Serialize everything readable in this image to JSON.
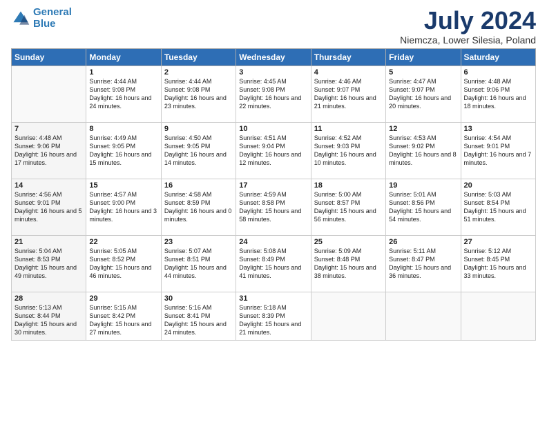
{
  "logo": {
    "line1": "General",
    "line2": "Blue"
  },
  "title": "July 2024",
  "subtitle": "Niemcza, Lower Silesia, Poland",
  "days_header": [
    "Sunday",
    "Monday",
    "Tuesday",
    "Wednesday",
    "Thursday",
    "Friday",
    "Saturday"
  ],
  "weeks": [
    [
      {
        "num": "",
        "sunrise": "",
        "sunset": "",
        "daylight": ""
      },
      {
        "num": "1",
        "sunrise": "Sunrise: 4:44 AM",
        "sunset": "Sunset: 9:08 PM",
        "daylight": "Daylight: 16 hours and 24 minutes."
      },
      {
        "num": "2",
        "sunrise": "Sunrise: 4:44 AM",
        "sunset": "Sunset: 9:08 PM",
        "daylight": "Daylight: 16 hours and 23 minutes."
      },
      {
        "num": "3",
        "sunrise": "Sunrise: 4:45 AM",
        "sunset": "Sunset: 9:08 PM",
        "daylight": "Daylight: 16 hours and 22 minutes."
      },
      {
        "num": "4",
        "sunrise": "Sunrise: 4:46 AM",
        "sunset": "Sunset: 9:07 PM",
        "daylight": "Daylight: 16 hours and 21 minutes."
      },
      {
        "num": "5",
        "sunrise": "Sunrise: 4:47 AM",
        "sunset": "Sunset: 9:07 PM",
        "daylight": "Daylight: 16 hours and 20 minutes."
      },
      {
        "num": "6",
        "sunrise": "Sunrise: 4:48 AM",
        "sunset": "Sunset: 9:06 PM",
        "daylight": "Daylight: 16 hours and 18 minutes."
      }
    ],
    [
      {
        "num": "7",
        "sunrise": "Sunrise: 4:48 AM",
        "sunset": "Sunset: 9:06 PM",
        "daylight": "Daylight: 16 hours and 17 minutes."
      },
      {
        "num": "8",
        "sunrise": "Sunrise: 4:49 AM",
        "sunset": "Sunset: 9:05 PM",
        "daylight": "Daylight: 16 hours and 15 minutes."
      },
      {
        "num": "9",
        "sunrise": "Sunrise: 4:50 AM",
        "sunset": "Sunset: 9:05 PM",
        "daylight": "Daylight: 16 hours and 14 minutes."
      },
      {
        "num": "10",
        "sunrise": "Sunrise: 4:51 AM",
        "sunset": "Sunset: 9:04 PM",
        "daylight": "Daylight: 16 hours and 12 minutes."
      },
      {
        "num": "11",
        "sunrise": "Sunrise: 4:52 AM",
        "sunset": "Sunset: 9:03 PM",
        "daylight": "Daylight: 16 hours and 10 minutes."
      },
      {
        "num": "12",
        "sunrise": "Sunrise: 4:53 AM",
        "sunset": "Sunset: 9:02 PM",
        "daylight": "Daylight: 16 hours and 8 minutes."
      },
      {
        "num": "13",
        "sunrise": "Sunrise: 4:54 AM",
        "sunset": "Sunset: 9:01 PM",
        "daylight": "Daylight: 16 hours and 7 minutes."
      }
    ],
    [
      {
        "num": "14",
        "sunrise": "Sunrise: 4:56 AM",
        "sunset": "Sunset: 9:01 PM",
        "daylight": "Daylight: 16 hours and 5 minutes."
      },
      {
        "num": "15",
        "sunrise": "Sunrise: 4:57 AM",
        "sunset": "Sunset: 9:00 PM",
        "daylight": "Daylight: 16 hours and 3 minutes."
      },
      {
        "num": "16",
        "sunrise": "Sunrise: 4:58 AM",
        "sunset": "Sunset: 8:59 PM",
        "daylight": "Daylight: 16 hours and 0 minutes."
      },
      {
        "num": "17",
        "sunrise": "Sunrise: 4:59 AM",
        "sunset": "Sunset: 8:58 PM",
        "daylight": "Daylight: 15 hours and 58 minutes."
      },
      {
        "num": "18",
        "sunrise": "Sunrise: 5:00 AM",
        "sunset": "Sunset: 8:57 PM",
        "daylight": "Daylight: 15 hours and 56 minutes."
      },
      {
        "num": "19",
        "sunrise": "Sunrise: 5:01 AM",
        "sunset": "Sunset: 8:56 PM",
        "daylight": "Daylight: 15 hours and 54 minutes."
      },
      {
        "num": "20",
        "sunrise": "Sunrise: 5:03 AM",
        "sunset": "Sunset: 8:54 PM",
        "daylight": "Daylight: 15 hours and 51 minutes."
      }
    ],
    [
      {
        "num": "21",
        "sunrise": "Sunrise: 5:04 AM",
        "sunset": "Sunset: 8:53 PM",
        "daylight": "Daylight: 15 hours and 49 minutes."
      },
      {
        "num": "22",
        "sunrise": "Sunrise: 5:05 AM",
        "sunset": "Sunset: 8:52 PM",
        "daylight": "Daylight: 15 hours and 46 minutes."
      },
      {
        "num": "23",
        "sunrise": "Sunrise: 5:07 AM",
        "sunset": "Sunset: 8:51 PM",
        "daylight": "Daylight: 15 hours and 44 minutes."
      },
      {
        "num": "24",
        "sunrise": "Sunrise: 5:08 AM",
        "sunset": "Sunset: 8:49 PM",
        "daylight": "Daylight: 15 hours and 41 minutes."
      },
      {
        "num": "25",
        "sunrise": "Sunrise: 5:09 AM",
        "sunset": "Sunset: 8:48 PM",
        "daylight": "Daylight: 15 hours and 38 minutes."
      },
      {
        "num": "26",
        "sunrise": "Sunrise: 5:11 AM",
        "sunset": "Sunset: 8:47 PM",
        "daylight": "Daylight: 15 hours and 36 minutes."
      },
      {
        "num": "27",
        "sunrise": "Sunrise: 5:12 AM",
        "sunset": "Sunset: 8:45 PM",
        "daylight": "Daylight: 15 hours and 33 minutes."
      }
    ],
    [
      {
        "num": "28",
        "sunrise": "Sunrise: 5:13 AM",
        "sunset": "Sunset: 8:44 PM",
        "daylight": "Daylight: 15 hours and 30 minutes."
      },
      {
        "num": "29",
        "sunrise": "Sunrise: 5:15 AM",
        "sunset": "Sunset: 8:42 PM",
        "daylight": "Daylight: 15 hours and 27 minutes."
      },
      {
        "num": "30",
        "sunrise": "Sunrise: 5:16 AM",
        "sunset": "Sunset: 8:41 PM",
        "daylight": "Daylight: 15 hours and 24 minutes."
      },
      {
        "num": "31",
        "sunrise": "Sunrise: 5:18 AM",
        "sunset": "Sunset: 8:39 PM",
        "daylight": "Daylight: 15 hours and 21 minutes."
      },
      {
        "num": "",
        "sunrise": "",
        "sunset": "",
        "daylight": ""
      },
      {
        "num": "",
        "sunrise": "",
        "sunset": "",
        "daylight": ""
      },
      {
        "num": "",
        "sunrise": "",
        "sunset": "",
        "daylight": ""
      }
    ]
  ]
}
